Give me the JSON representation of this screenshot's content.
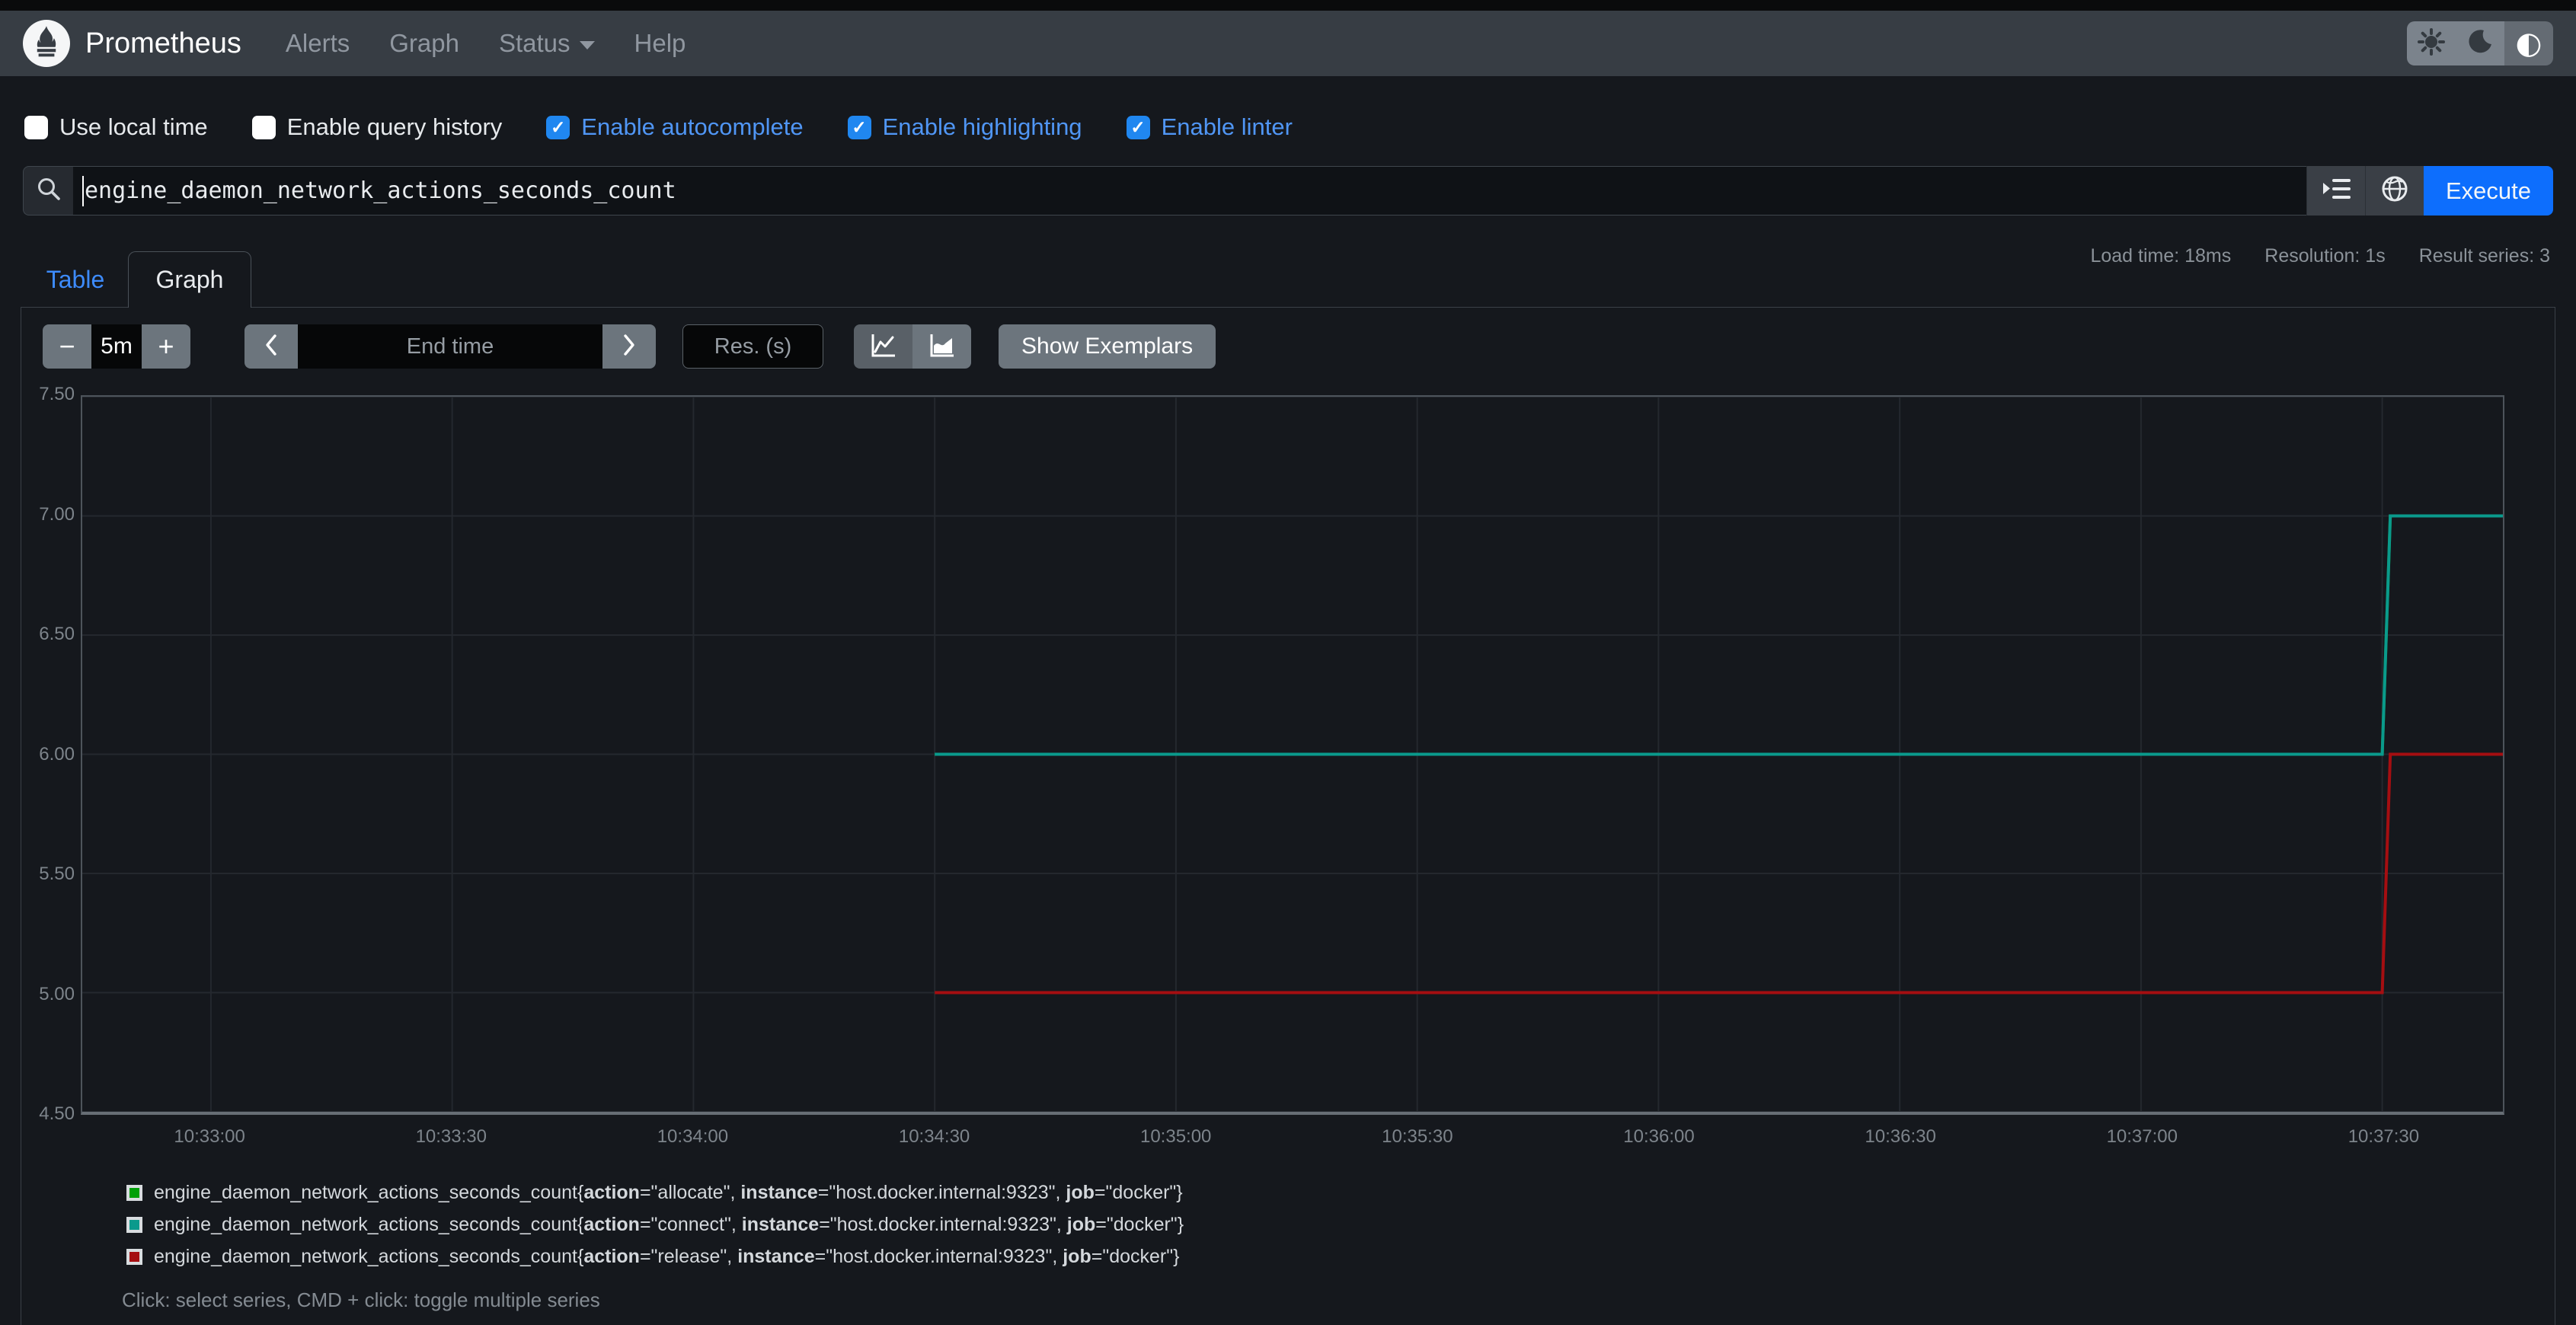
{
  "navbar": {
    "brand": "Prometheus",
    "links": [
      {
        "label": "Alerts"
      },
      {
        "label": "Graph"
      },
      {
        "label": "Status",
        "dropdown": true
      },
      {
        "label": "Help"
      }
    ],
    "theme_toggle": {
      "options": [
        "light",
        "dark",
        "auto"
      ],
      "active": "auto"
    }
  },
  "options_bar": {
    "checkboxes": [
      {
        "label": "Use local time",
        "checked": false
      },
      {
        "label": "Enable query history",
        "checked": false
      },
      {
        "label": "Enable autocomplete",
        "checked": true
      },
      {
        "label": "Enable highlighting",
        "checked": true
      },
      {
        "label": "Enable linter",
        "checked": true
      }
    ]
  },
  "query_bar": {
    "value": "engine_daemon_network_actions_seconds_count",
    "execute_label": "Execute"
  },
  "stats": {
    "load_time": "Load time: 18ms",
    "resolution": "Resolution: 1s",
    "result_series": "Result series: 3"
  },
  "tabs": [
    {
      "label": "Table",
      "active": false
    },
    {
      "label": "Graph",
      "active": true
    }
  ],
  "graph_controls": {
    "range_value": "5m",
    "end_time_placeholder": "End time",
    "res_placeholder": "Res. (s)",
    "show_exemplars_label": "Show Exemplars"
  },
  "chart_data": {
    "type": "line",
    "x_start": "10:32:44",
    "x_end": "10:37:45",
    "x_ticks": [
      "10:33:00",
      "10:33:30",
      "10:34:00",
      "10:34:30",
      "10:35:00",
      "10:35:30",
      "10:36:00",
      "10:36:30",
      "10:37:00",
      "10:37:30"
    ],
    "ylim": [
      4.5,
      7.5
    ],
    "y_ticks": [
      7.5,
      7.0,
      6.5,
      6.0,
      5.5,
      5.0,
      4.5
    ],
    "grid": true,
    "series": [
      {
        "name": "allocate",
        "color": "#00a008",
        "points": [
          [
            "10:34:30",
            6
          ],
          [
            "10:37:30",
            6
          ],
          [
            "10:37:31",
            7
          ],
          [
            "10:37:45",
            7
          ]
        ]
      },
      {
        "name": "connect",
        "color": "#0a9a8c",
        "points": [
          [
            "10:34:30",
            6
          ],
          [
            "10:37:30",
            6
          ],
          [
            "10:37:31",
            7
          ],
          [
            "10:37:45",
            7
          ]
        ]
      },
      {
        "name": "release",
        "color": "#a50e11",
        "points": [
          [
            "10:34:30",
            5
          ],
          [
            "10:37:30",
            5
          ],
          [
            "10:37:31",
            6
          ],
          [
            "10:37:45",
            6
          ]
        ]
      }
    ]
  },
  "legend": {
    "items": [
      {
        "color": "#00a008",
        "metric": "engine_daemon_network_actions_seconds_count",
        "labels": [
          {
            "key": "action",
            "value": "allocate"
          },
          {
            "key": "instance",
            "value": "host.docker.internal:9323"
          },
          {
            "key": "job",
            "value": "docker"
          }
        ]
      },
      {
        "color": "#0a9a8c",
        "metric": "engine_daemon_network_actions_seconds_count",
        "labels": [
          {
            "key": "action",
            "value": "connect"
          },
          {
            "key": "instance",
            "value": "host.docker.internal:9323"
          },
          {
            "key": "job",
            "value": "docker"
          }
        ]
      },
      {
        "color": "#a50e11",
        "metric": "engine_daemon_network_actions_seconds_count",
        "labels": [
          {
            "key": "action",
            "value": "release"
          },
          {
            "key": "instance",
            "value": "host.docker.internal:9323"
          },
          {
            "key": "job",
            "value": "docker"
          }
        ]
      }
    ]
  },
  "footer_hint": "Click: select series, CMD + click: toggle multiple series",
  "colors": {
    "navbar_bg": "#373d44",
    "page_bg": "#15181d",
    "accent_blue": "#0d6efd",
    "checkbox_blue": "#2087f0",
    "checked_label_blue": "#5096f5",
    "tab_link_blue": "#3d8bfd",
    "button_gray": "#6c757d",
    "grid_line": "#24282e",
    "series_green": "#00a008",
    "series_teal": "#0a9a8c",
    "series_red": "#a50e11"
  }
}
